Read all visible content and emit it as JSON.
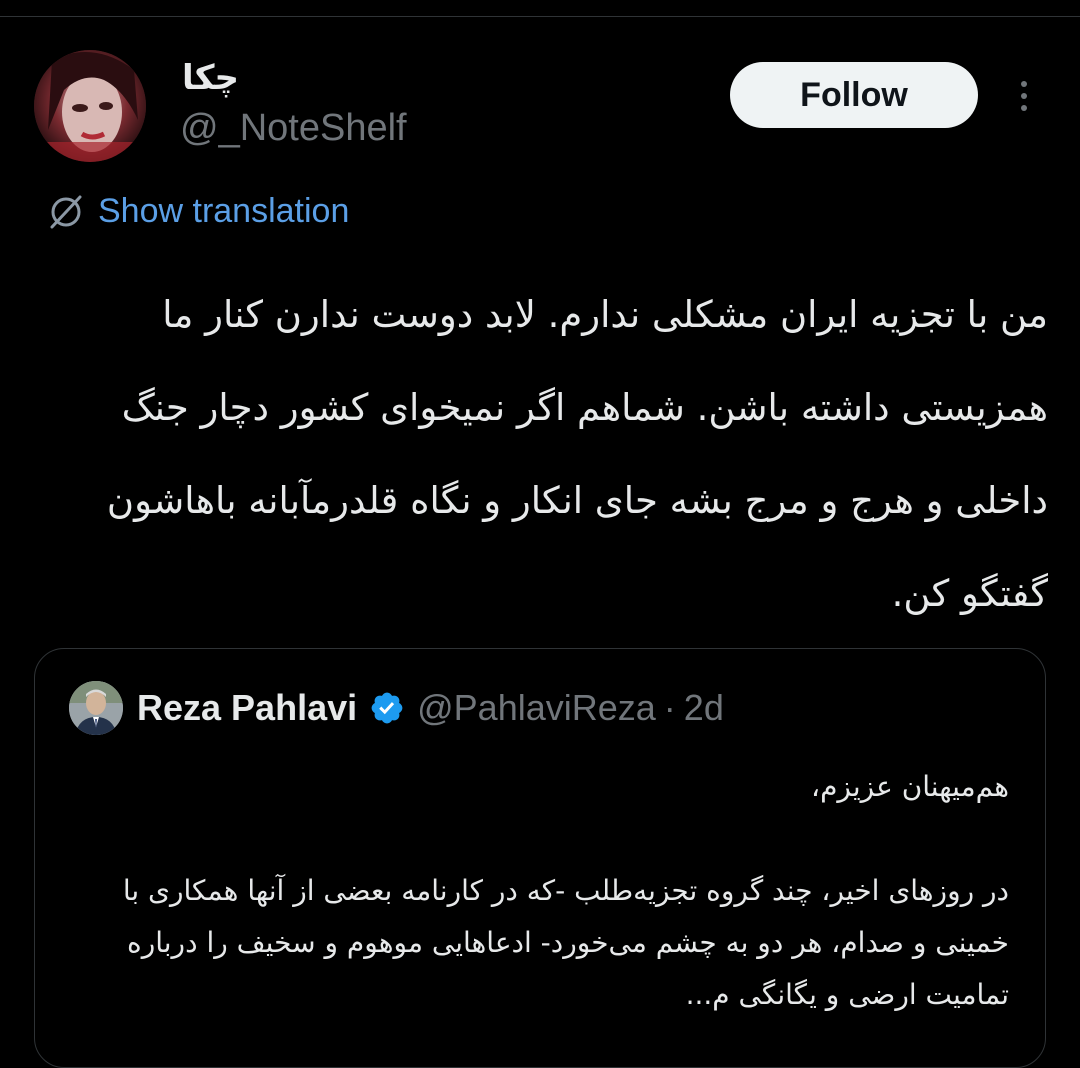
{
  "tweet": {
    "author": {
      "display_name": "چکا",
      "handle": "@_NoteShelf",
      "avatar_icon": "profile-photo"
    },
    "follow_label": "Follow",
    "more_icon": "more-vertical-icon",
    "translation": {
      "icon": "globe-slash-icon",
      "label": "Show translation"
    },
    "text": "من با تجزیه ایران مشکلی ندارم. لابد دوست ندارن کنار ما همزیستی داشته باشن. شماهم اگر نمیخوای کشور دچار جنگ داخلی و هرج و مرج بشه جای انکار و نگاه قلدرمآبانه باهاشون گفتگو کن."
  },
  "quoted_tweet": {
    "author": {
      "display_name": "Reza Pahlavi",
      "verified_icon": "verified-badge-icon",
      "handle": "@PahlaviReza",
      "separator": "·",
      "time": "2d"
    },
    "greeting": "هم‌میهنان عزیزم،",
    "body": "در روزهای اخیر، چند گروه تجزیه‌طلب -که در کارنامه بعضی از آنها همکاری با خمینی و صدام، هر دو به چشم می‌خورد- ادعاهایی موهوم و سخیف را درباره تمامیت ارضی و یگانگی م..."
  },
  "colors": {
    "background": "#000000",
    "text": "#e7e9ea",
    "muted": "#71767b",
    "link": "#5b9fe6",
    "border": "#2f3336",
    "verified": "#1d9bf0"
  }
}
